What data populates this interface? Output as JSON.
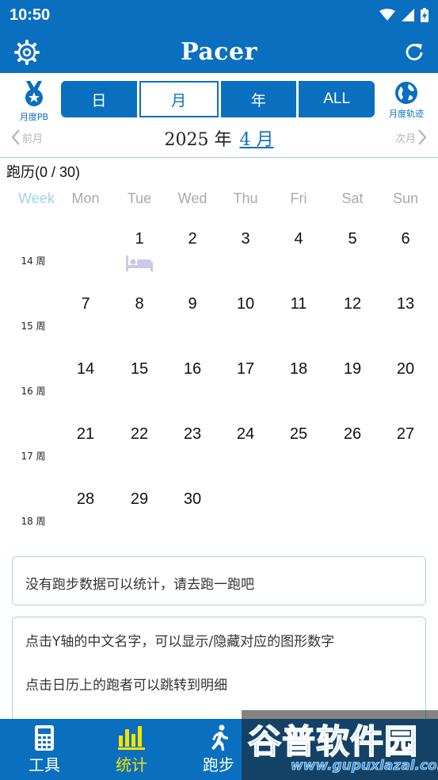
{
  "status_bar": {
    "time": "10:50"
  },
  "app_bar": {
    "title": "Pacer",
    "left_icon": "gear-icon",
    "right_icon": "refresh-icon"
  },
  "range_tabs": {
    "monthly_pb_label": "月度PB",
    "monthly_track_label": "月度轨迹",
    "tabs": [
      {
        "label": "日"
      },
      {
        "label": "月"
      },
      {
        "label": "年"
      },
      {
        "label": "ALL"
      }
    ],
    "selected": "月"
  },
  "month_nav": {
    "prev_label": "前月",
    "next_label": "次月",
    "year_text": "2025 年",
    "month_text": "4 月"
  },
  "calendar": {
    "heading": "跑历(0 / 30)",
    "headers": [
      "Week",
      "Mon",
      "Tue",
      "Wed",
      "Thu",
      "Fri",
      "Sat",
      "Sun"
    ],
    "week_labels": [
      "14 周",
      "15 周",
      "16 周",
      "17 周",
      "18 周"
    ],
    "days": [
      "1",
      "2",
      "3",
      "4",
      "5",
      "6",
      "7",
      "8",
      "9",
      "10",
      "11",
      "12",
      "13",
      "14",
      "15",
      "16",
      "17",
      "18",
      "19",
      "20",
      "21",
      "22",
      "23",
      "24",
      "25",
      "26",
      "27",
      "28",
      "29",
      "30"
    ],
    "rest_day_icon": "bed-icon"
  },
  "stats_empty_text": "没有跑步数据可以统计，请去跑一跑吧",
  "tips": [
    "点击Y轴的中文名字，可以显示/隐藏对应的图形数字",
    "点击日历上的跑者可以跳转到明细"
  ],
  "bottom_nav": [
    {
      "label": "工具",
      "icon": "calculator-icon"
    },
    {
      "label": "统计",
      "icon": "bar-chart-icon"
    },
    {
      "label": "跑步",
      "icon": "runner-icon"
    }
  ],
  "watermark": {
    "text": "谷普软件园",
    "url": "www.gupuxlazal.com"
  },
  "colors": {
    "primary": "#0b6fc0",
    "active_nav": "#f5e200",
    "border": "#a8d2ec"
  }
}
